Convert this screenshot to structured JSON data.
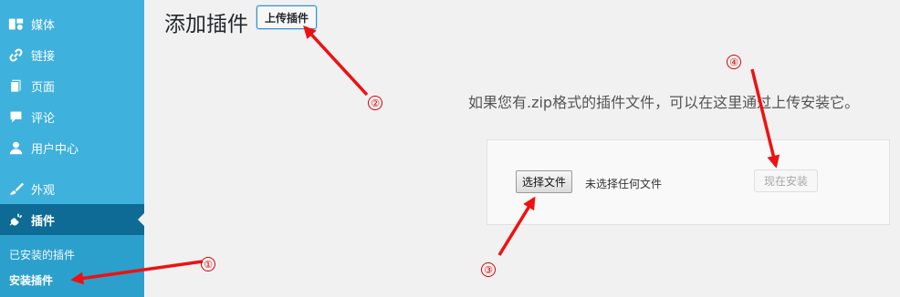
{
  "sidebar": {
    "items": [
      {
        "label": "媒体",
        "icon": "media-icon"
      },
      {
        "label": "链接",
        "icon": "link-icon"
      },
      {
        "label": "页面",
        "icon": "page-icon"
      },
      {
        "label": "评论",
        "icon": "comment-icon"
      },
      {
        "label": "用户中心",
        "icon": "user-icon"
      },
      {
        "label": "外观",
        "icon": "brush-icon"
      },
      {
        "label": "插件",
        "icon": "plug-icon",
        "current": true
      }
    ],
    "submenu": [
      {
        "label": "已安装的插件"
      },
      {
        "label": "安装插件",
        "current": true
      }
    ]
  },
  "main": {
    "title": "添加插件",
    "upload_button": "上传插件",
    "description": "如果您有.zip格式的插件文件，可以在这里通过上传安装它。",
    "choose_file_button": "选择文件",
    "no_file_text": "未选择任何文件",
    "install_button": "现在安装"
  },
  "annotations": {
    "labels": [
      "①",
      "②",
      "③",
      "④"
    ],
    "color": "#ee1111"
  },
  "colors": {
    "sidebar_bg": "#3eb1dc",
    "sidebar_current": "#0e6b96",
    "submenu_bg": "#2ca0cc",
    "page_bg": "#f1f1f1"
  }
}
